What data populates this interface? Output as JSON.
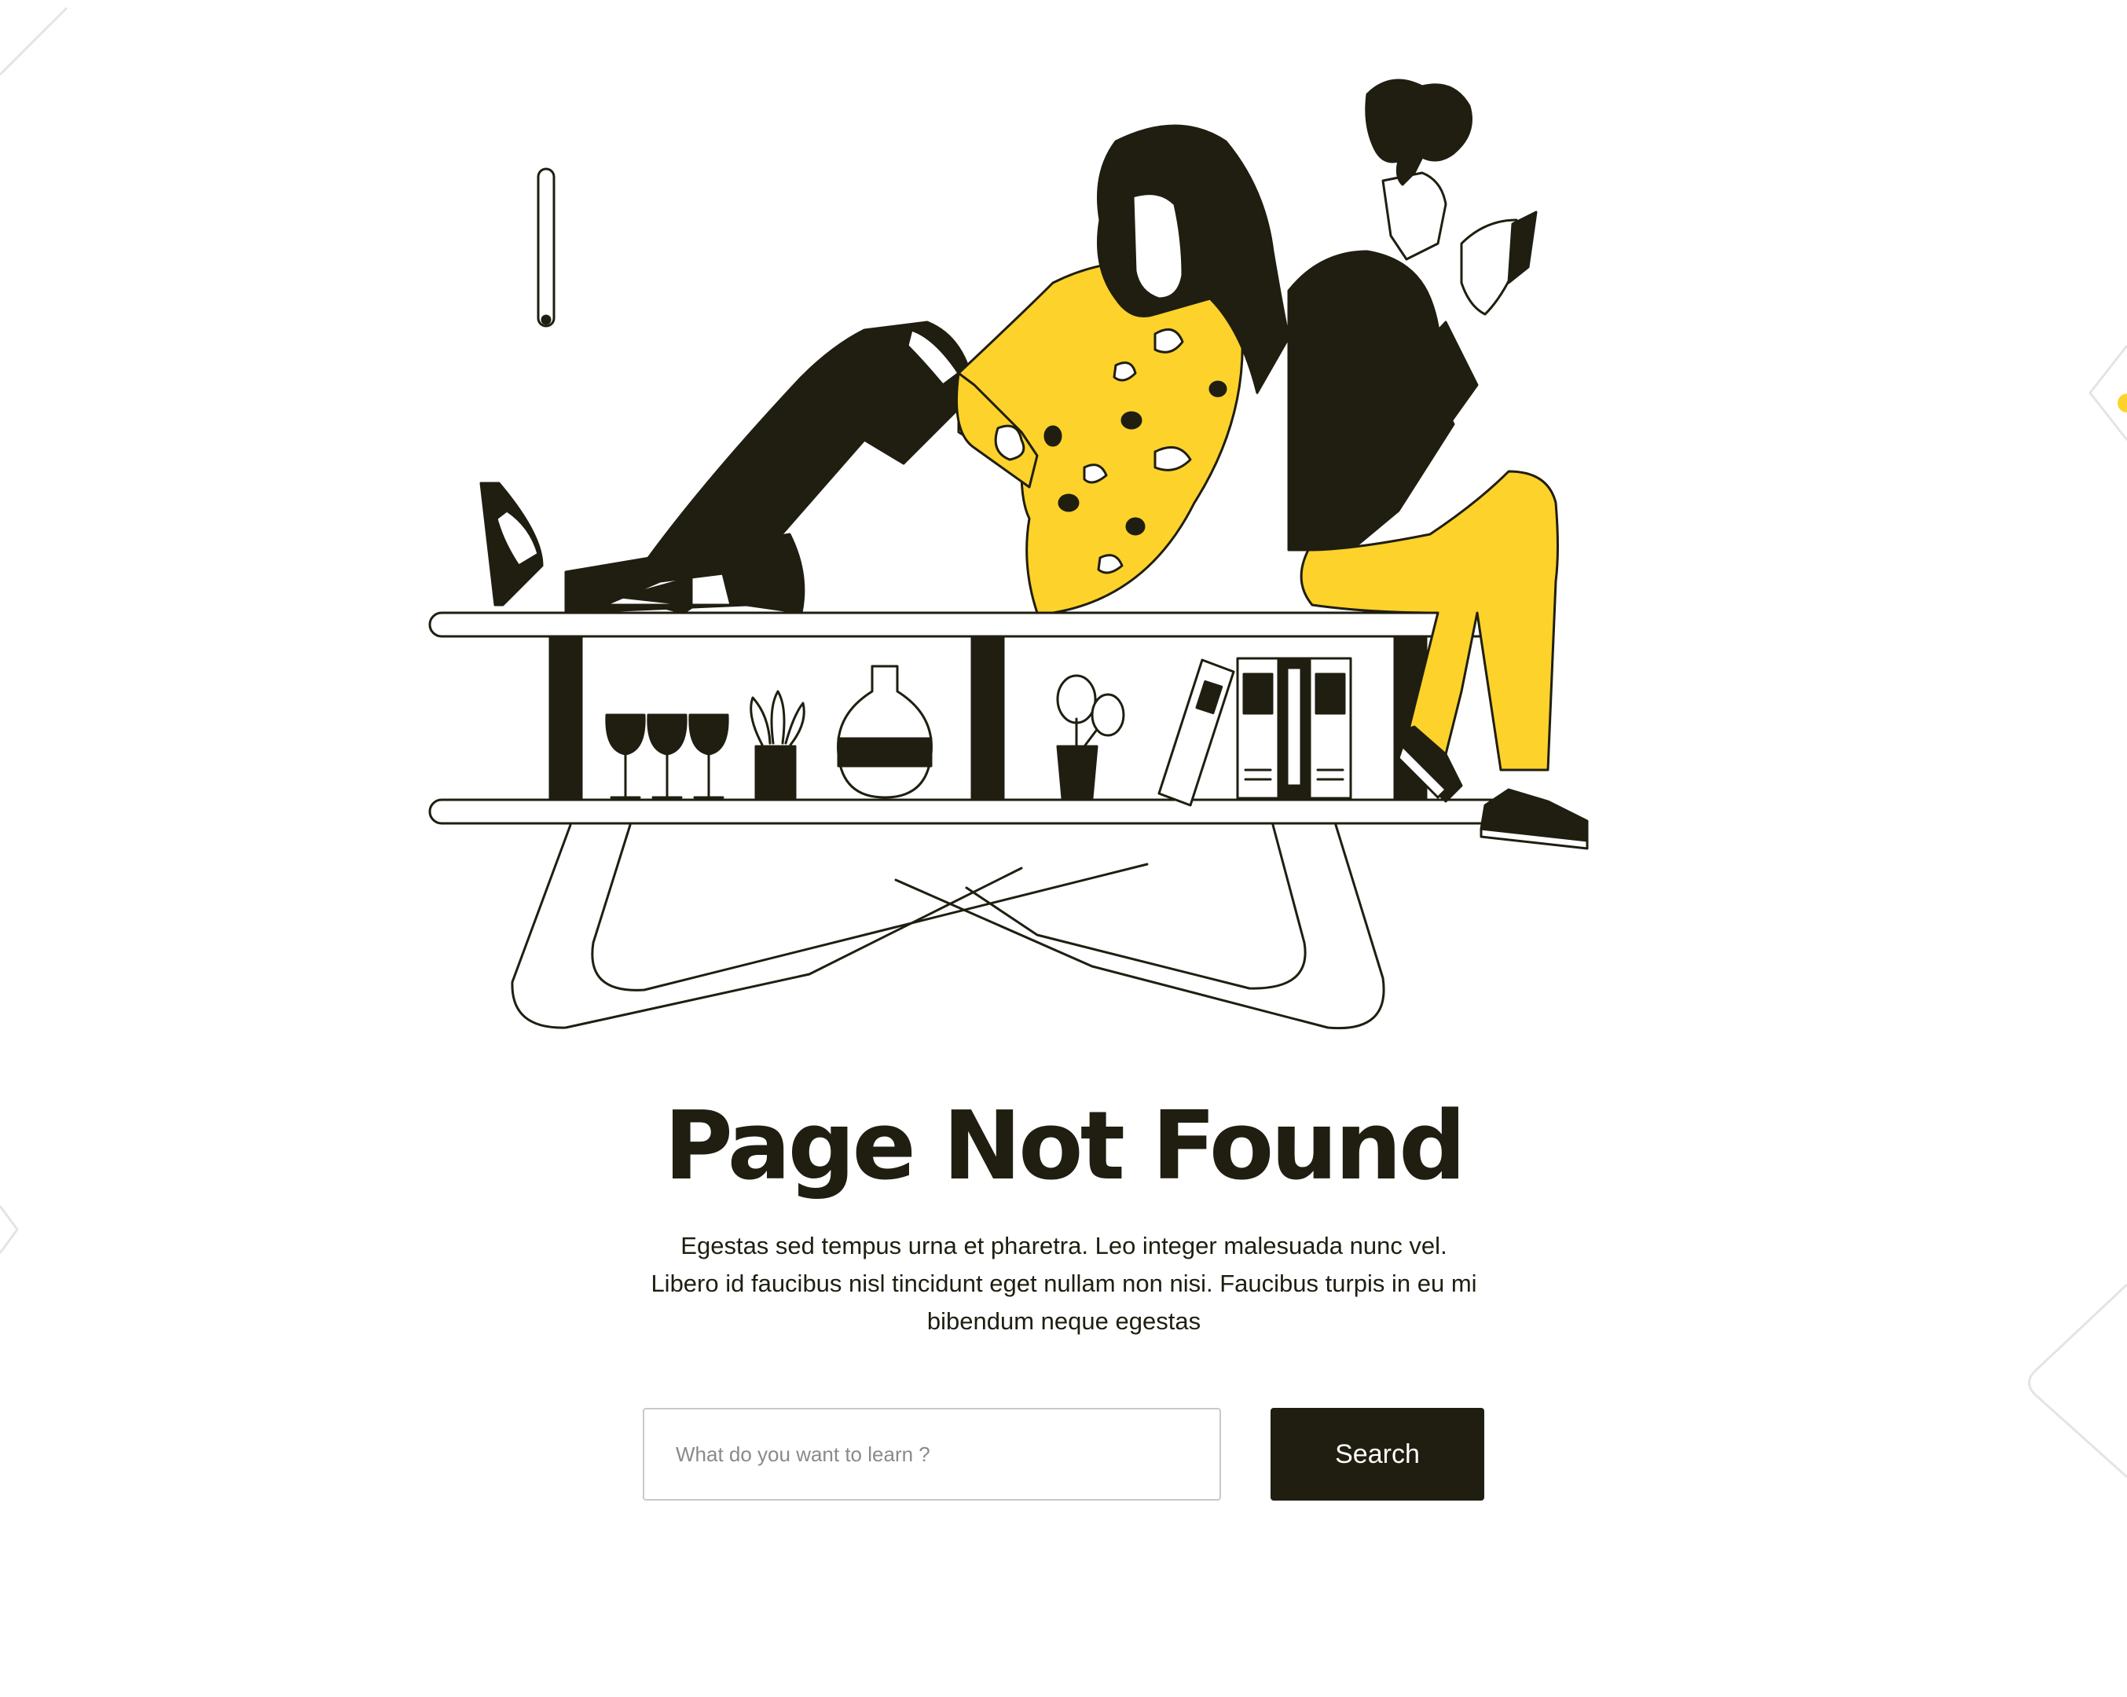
{
  "page": {
    "title": "Page Not Found",
    "description": "Egestas sed tempus urna et pharetra. Leo integer malesuada nunc vel. Libero id faucibus nisl tincidunt eget nullam non nisi. Faucibus turpis in eu mi bibendum neque egestas"
  },
  "search": {
    "placeholder": "What do you want to learn ?",
    "button_label": "Search"
  },
  "colors": {
    "dark": "#1f1e10",
    "accent": "#fdd22b",
    "background": "#ffffff",
    "input_border": "#c9c9c9"
  },
  "illustration": {
    "name": "people-reading-on-bookshelf"
  }
}
